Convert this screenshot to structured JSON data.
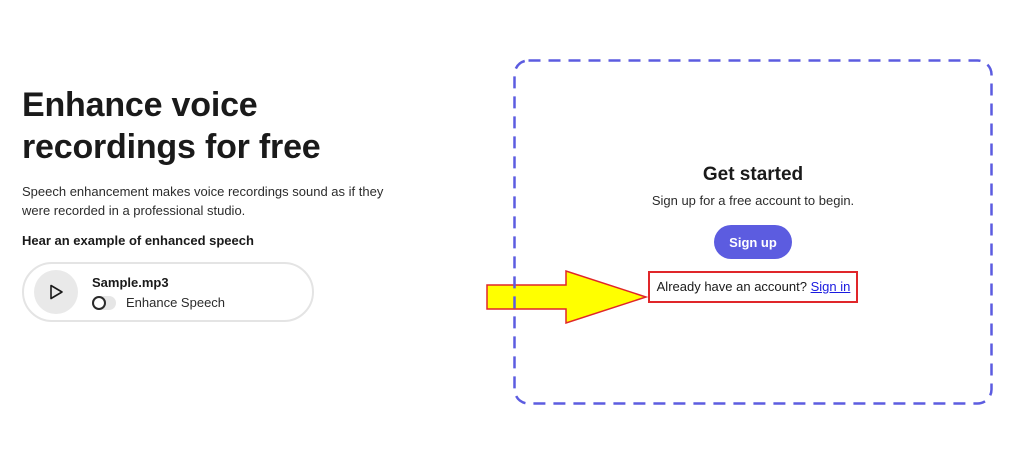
{
  "hero": {
    "headline_line1": "Enhance voice",
    "headline_line2": "recordings for free",
    "description": "Speech enhancement makes voice recordings sound as if they were recorded in a professional studio.",
    "example_heading": "Hear an example of enhanced speech"
  },
  "player": {
    "file_name": "Sample.mp3",
    "toggle_label": "Enhance Speech",
    "toggle_on": false,
    "play_icon": "play-icon"
  },
  "card": {
    "title": "Get started",
    "subtitle": "Sign up for a free account to begin.",
    "signup_label": "Sign up",
    "signin_prompt": "Already have an account?",
    "signin_link": "Sign in"
  },
  "annotation": {
    "arrow_icon": "arrow-right-icon",
    "arrow_color": "#ffff00",
    "highlight_color": "#e0262a"
  },
  "colors": {
    "accent": "#5c5ce0",
    "link": "#1a1ae0",
    "dashed_border": "#5c5ce0"
  }
}
